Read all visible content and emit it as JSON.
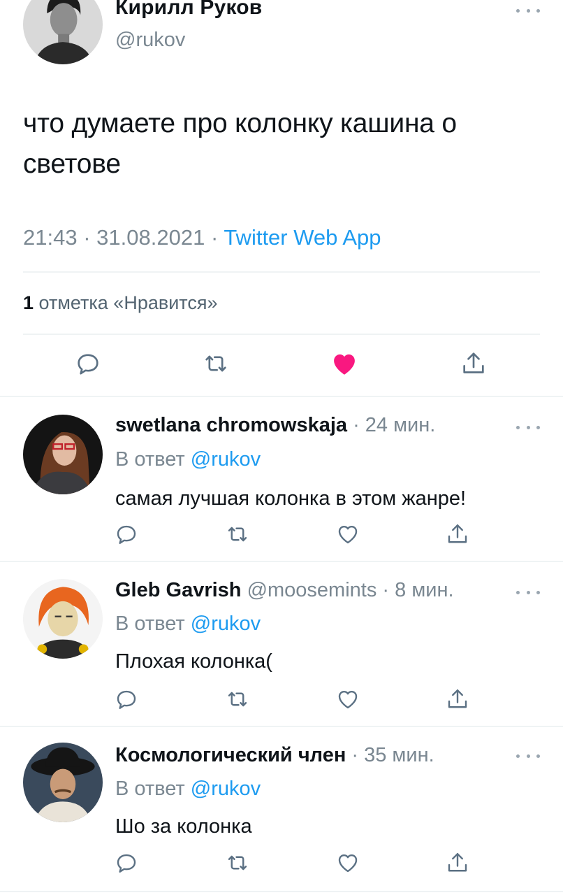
{
  "main_tweet": {
    "author_name": "Кирилл Руков",
    "author_handle": "@rukov",
    "text": "что думаете про колонку кашина о светове",
    "time": "21:43",
    "separator": "·",
    "date": "31.08.2021",
    "client": "Twitter Web App",
    "likes_count": "1",
    "likes_label": "отметка «Нравится»",
    "actions": [
      "reply-icon",
      "retweet-icon",
      "heart-filled-icon",
      "share-icon"
    ],
    "liked": true
  },
  "replies": [
    {
      "name": "swetlana chromowskaja",
      "handle": "",
      "time": "· 24 мин.",
      "reply_prefix": "В ответ",
      "reply_to": "@rukov",
      "text": "самая лучшая колонка в этом жанре!"
    },
    {
      "name": "Gleb Gavrish",
      "handle": "@moosemints",
      "time": "· 8 мин.",
      "reply_prefix": "В ответ",
      "reply_to": "@rukov",
      "text": "Плохая колонка("
    },
    {
      "name": "Космологический член",
      "handle": "",
      "time": "· 35 мин.",
      "reply_prefix": "В ответ",
      "reply_to": "@rukov",
      "text": "Шо за колонка"
    }
  ],
  "colors": {
    "accent": "#1d9bf0",
    "like": "#f91880",
    "secondary_text": "#7a8791",
    "icon": "#5b7083",
    "divider": "#eff3f4"
  }
}
